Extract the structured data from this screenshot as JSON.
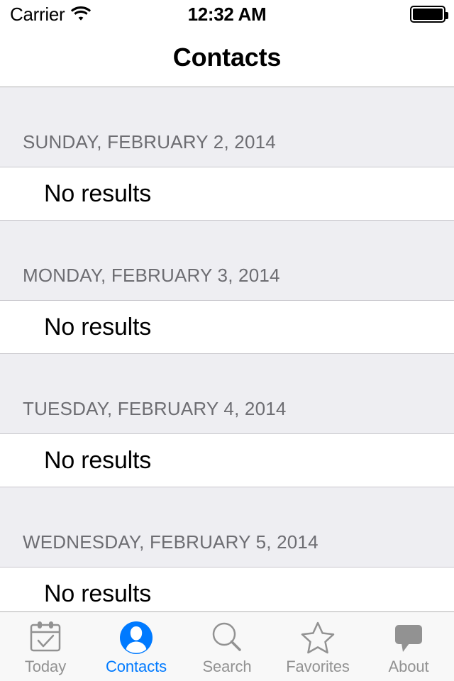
{
  "status_bar": {
    "carrier": "Carrier",
    "wifi_icon": "wifi-icon",
    "time": "12:32 AM",
    "battery_icon": "battery-full-icon"
  },
  "nav_bar": {
    "title": "Contacts"
  },
  "colors": {
    "accent": "#007aff",
    "inactive_tab": "#929292",
    "section_header_bg": "#eeeef2",
    "section_header_text": "#6d6d72",
    "row_bg": "#ffffff",
    "separator": "#c8c7cc",
    "tab_bar_bg": "#f8f8f8"
  },
  "list": {
    "sections": [
      {
        "header": "SUNDAY, FEBRUARY 2, 2014",
        "rows": [
          {
            "label": "No results"
          }
        ]
      },
      {
        "header": "MONDAY, FEBRUARY 3, 2014",
        "rows": [
          {
            "label": "No results"
          }
        ]
      },
      {
        "header": "TUESDAY, FEBRUARY 4, 2014",
        "rows": [
          {
            "label": "No results"
          }
        ]
      },
      {
        "header": "WEDNESDAY, FEBRUARY 5, 2014",
        "rows": [
          {
            "label": "No results"
          }
        ]
      }
    ]
  },
  "tab_bar": {
    "items": [
      {
        "label": "Today",
        "icon": "calendar-check-icon",
        "active": false
      },
      {
        "label": "Contacts",
        "icon": "person-circle-icon",
        "active": true
      },
      {
        "label": "Search",
        "icon": "magnifier-icon",
        "active": false
      },
      {
        "label": "Favorites",
        "icon": "star-icon",
        "active": false
      },
      {
        "label": "About",
        "icon": "speech-bubble-icon",
        "active": false
      }
    ]
  }
}
